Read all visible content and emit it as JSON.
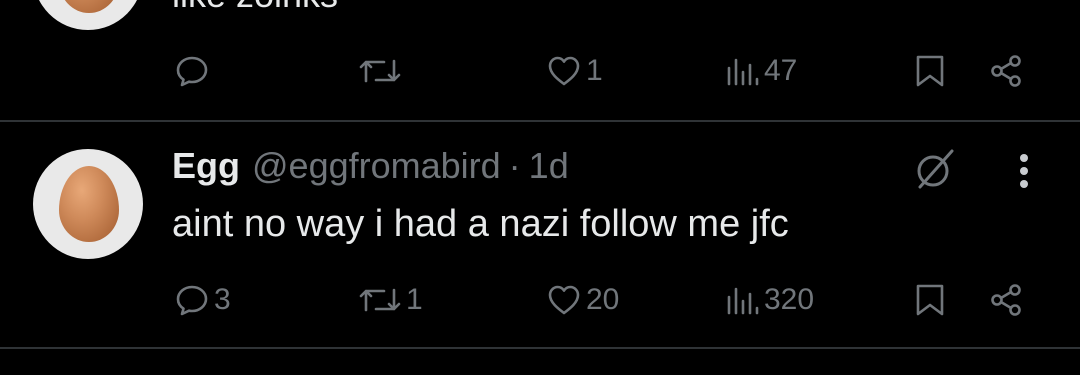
{
  "previous_tweet": {
    "text_partial": "like zoinks",
    "actions": {
      "reply": "",
      "retweet": "",
      "like": "1",
      "views": "47"
    }
  },
  "tweet": {
    "display_name": "Egg",
    "handle": "@eggfromabird",
    "separator": "·",
    "time": "1d",
    "text": "aint no way i had a nazi follow me jfc",
    "actions": {
      "reply": "3",
      "retweet": "1",
      "like": "20",
      "views": "320"
    }
  },
  "icons": {
    "reply": "reply-icon",
    "retweet": "retweet-icon",
    "like": "heart-icon",
    "views": "views-icon",
    "bookmark": "bookmark-icon",
    "share": "share-icon",
    "mute": "slashed-circle-icon",
    "more": "more-vertical-icon"
  },
  "colors": {
    "background": "#000000",
    "text_primary": "#e7e9ea",
    "text_secondary": "#71767b",
    "divider": "#2f3336"
  }
}
